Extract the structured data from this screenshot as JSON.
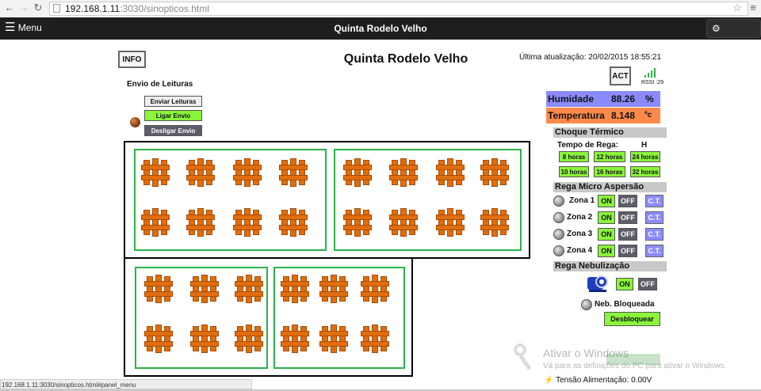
{
  "browser": {
    "url_host": "192.168.1.11",
    "url_rest": ":3030/sinopticos.html",
    "status_url": "192.168.1.11:3030/sinopticos.html#panel_menu"
  },
  "header": {
    "menu_label": "Menu",
    "title": "Quinta Rodelo Velho",
    "options_label": "Opções"
  },
  "page": {
    "info_label": "INFO",
    "title": "Quinta Rodelo Velho",
    "last_update": "Última atualização: 20/02/2015 18:55:21",
    "act_label": "ACT",
    "rssi": "RSSI :29"
  },
  "leituras": {
    "title": "Envio de Leituras",
    "send": "Enviar Leituras",
    "on": "Ligar Envio",
    "off": "Desligar Envio"
  },
  "sensors": {
    "humidity_label": "Humidade",
    "humidity_value": "88.26",
    "humidity_unit": "%",
    "temp_label": "Temperatura",
    "temp_value": "8.148",
    "temp_unit": "ºc",
    "humidity_color": "#8b8bff",
    "temp_color": "#ff8a4a"
  },
  "choque": {
    "title": "Choque Térmico",
    "tempo_label": "Tempo de Rega:",
    "tempo_value": "H",
    "options": [
      "8 horas",
      "12 horas",
      "24 horas",
      "10 horas",
      "16 horas",
      "32 horas"
    ]
  },
  "micro": {
    "title": "Rega Micro Aspersão",
    "zones": [
      {
        "label": "Zona 1",
        "on": "ON",
        "off": "OFF",
        "ct": "C.T."
      },
      {
        "label": "Zona 2",
        "on": "ON",
        "off": "OFF",
        "ct": "C.T."
      },
      {
        "label": "Zona 3",
        "on": "ON",
        "off": "OFF",
        "ct": "C.T."
      },
      {
        "label": "Zona 4",
        "on": "ON",
        "off": "OFF",
        "ct": "C.T."
      }
    ]
  },
  "nebul": {
    "title": "Rega Nebulização",
    "on": "ON",
    "off": "OFF",
    "blocked": "Neb. Bloqueada",
    "unlock": "Desbloquear"
  },
  "footer": {
    "tension": "Tensão Alimentação: 0.00V",
    "watermark_title": "Ativar o Windows",
    "watermark_sub": "Vá para as definições do PC para ativar o Windows."
  }
}
